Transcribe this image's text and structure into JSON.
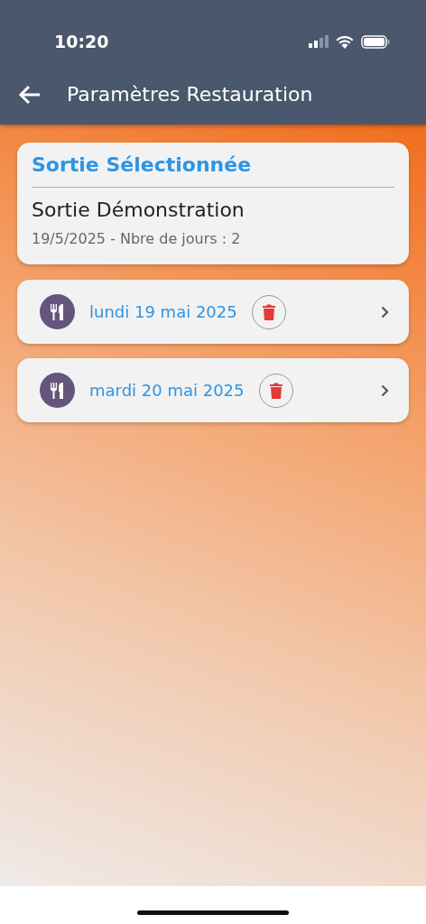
{
  "status_bar": {
    "time": "10:20"
  },
  "app_bar": {
    "title": "Paramètres Restauration"
  },
  "outing": {
    "heading": "Sortie Sélectionnée",
    "name": "Sortie Démonstration",
    "details": "19/5/2025 - Nbre de jours : 2"
  },
  "days": [
    {
      "label": "lundi 19 mai 2025"
    },
    {
      "label": "mardi 20 mai 2025"
    }
  ]
}
